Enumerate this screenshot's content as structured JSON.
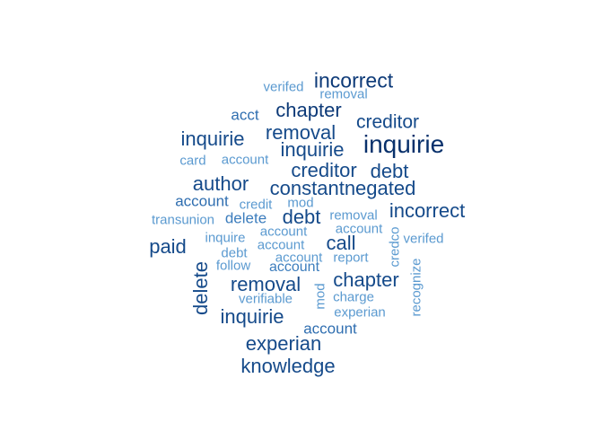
{
  "colors": {
    "darkest": "#08306b",
    "dark": "#1f4e8c",
    "mid": "#2f6eb0",
    "light": "#4f8fc6",
    "lightest": "#6aa3d4"
  },
  "words": [
    {
      "text": "inquirie",
      "color": "#08306b"
    },
    {
      "text": "incorrect",
      "color": "#0d3a78"
    },
    {
      "text": "chapter",
      "color": "#0d3a78"
    },
    {
      "text": "creditor",
      "color": "#154a8a"
    },
    {
      "text": "inquirie",
      "color": "#154a8a"
    },
    {
      "text": "removal",
      "color": "#154a8a"
    },
    {
      "text": "inquirie",
      "color": "#154a8a"
    },
    {
      "text": "constantnegated",
      "color": "#154a8a"
    },
    {
      "text": "author",
      "color": "#154a8a"
    },
    {
      "text": "creditor",
      "color": "#154a8a"
    },
    {
      "text": "debt",
      "color": "#154a8a"
    },
    {
      "text": "incorrect",
      "color": "#154a8a"
    },
    {
      "text": "debt",
      "color": "#154a8a"
    },
    {
      "text": "paid",
      "color": "#154a8a"
    },
    {
      "text": "call",
      "color": "#154a8a"
    },
    {
      "text": "removal",
      "color": "#154a8a"
    },
    {
      "text": "chapter",
      "color": "#154a8a"
    },
    {
      "text": "inquirie",
      "color": "#154a8a"
    },
    {
      "text": "experian",
      "color": "#154a8a"
    },
    {
      "text": "knowledge",
      "color": "#154a8a"
    },
    {
      "text": "delete",
      "color": "#154a8a"
    },
    {
      "text": "acct",
      "color": "#2f6eb0"
    },
    {
      "text": "account",
      "color": "#2f6eb0"
    },
    {
      "text": "account",
      "color": "#2f6eb0"
    },
    {
      "text": "verifed",
      "color": "#5b9ad0"
    },
    {
      "text": "removal",
      "color": "#5b9ad0"
    },
    {
      "text": "card",
      "color": "#5b9ad0"
    },
    {
      "text": "account",
      "color": "#5b9ad0"
    },
    {
      "text": "credit",
      "color": "#5b9ad0"
    },
    {
      "text": "mod",
      "color": "#5b9ad0"
    },
    {
      "text": "transunion",
      "color": "#5b9ad0"
    },
    {
      "text": "delete",
      "color": "#3c7dbd"
    },
    {
      "text": "removal",
      "color": "#5b9ad0"
    },
    {
      "text": "account",
      "color": "#5b9ad0"
    },
    {
      "text": "account",
      "color": "#5b9ad0"
    },
    {
      "text": "inquire",
      "color": "#5b9ad0"
    },
    {
      "text": "account",
      "color": "#5b9ad0"
    },
    {
      "text": "verifed",
      "color": "#5b9ad0"
    },
    {
      "text": "debt",
      "color": "#5b9ad0"
    },
    {
      "text": "account",
      "color": "#5b9ad0"
    },
    {
      "text": "report",
      "color": "#5b9ad0"
    },
    {
      "text": "follow",
      "color": "#5b9ad0"
    },
    {
      "text": "account",
      "color": "#3c7dbd"
    },
    {
      "text": "verifiable",
      "color": "#5b9ad0"
    },
    {
      "text": "charge",
      "color": "#5b9ad0"
    },
    {
      "text": "experian",
      "color": "#5b9ad0"
    },
    {
      "text": "credco",
      "color": "#5b9ad0"
    },
    {
      "text": "recognize",
      "color": "#5b9ad0"
    },
    {
      "text": "mod",
      "color": "#5b9ad0"
    }
  ]
}
